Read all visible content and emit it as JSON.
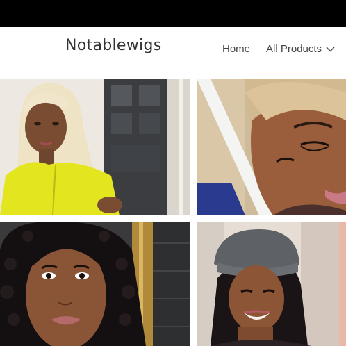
{
  "header": {
    "brand": "Notablewigs",
    "nav": {
      "home": "Home",
      "all_products": "All Products"
    }
  },
  "products": [
    {
      "name": "blonde-straight-wig-model",
      "hair_color": "#efe3c6"
    },
    {
      "name": "blonde-lace-wig-closeup",
      "hair_color": "#d9c09a"
    },
    {
      "name": "curly-black-wig-model",
      "hair_color": "#141012"
    },
    {
      "name": "straight-black-wig-beanie-model",
      "hair_color": "#1a1416"
    }
  ],
  "colors": {
    "topbar": "#000000",
    "nav_text": "#444444",
    "brand_text": "#333333"
  }
}
